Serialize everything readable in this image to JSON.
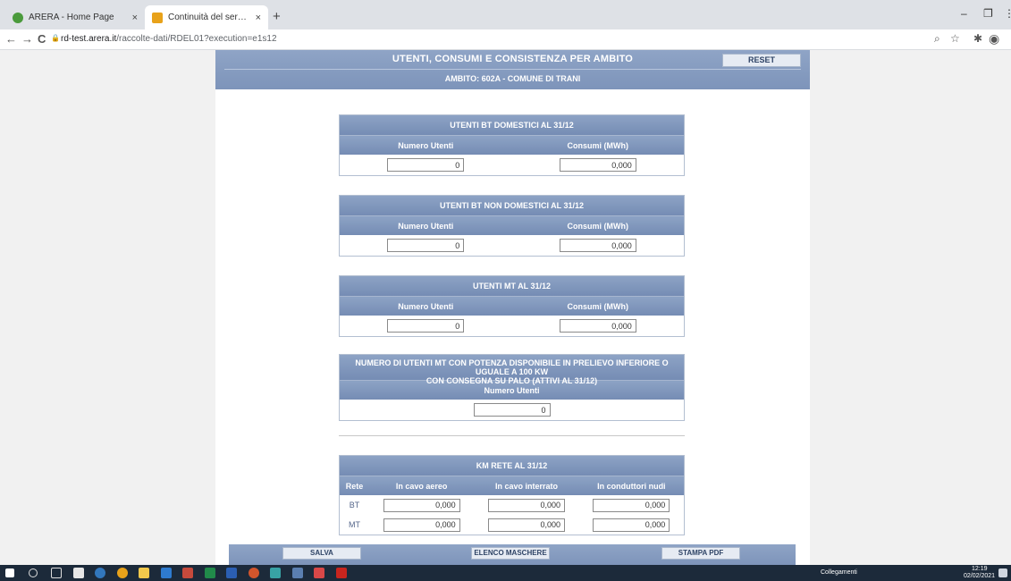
{
  "browser": {
    "tabs": [
      {
        "label": "ARERA - Home Page",
        "close": "×"
      },
      {
        "label": "Continuità del servizio elettrico",
        "close": "×"
      }
    ],
    "new_tab": "+",
    "url_host": "rd-test.arera.it",
    "url_path": "/raccolte-dati/RDEL01?execution=e1s12",
    "minimize": "–",
    "maximize": "❐",
    "kebab": "⋮",
    "back": "←",
    "forward": "→",
    "reload": "C",
    "lock": "🔒",
    "zoom_icon": "⌕",
    "star_icon": "☆",
    "ext_icon": "✱",
    "profile_icon": "◉",
    "colors": {
      "header": "#7d94ba",
      "chrome": "#dee1e6",
      "taskbar": "#1c2a3a"
    }
  },
  "page": {
    "title": "UTENTI, CONSUMI E CONSISTENZA PER AMBITO",
    "subtitle": "AMBITO: 602A - COMUNE DI TRANI",
    "reset_label": "RESET"
  },
  "sections": {
    "bt_domestici": {
      "title": "UTENTI BT DOMESTICI AL 31/12",
      "col1": "Numero Utenti",
      "col2": "Consumi (MWh)",
      "num_utenti": "0",
      "consumi": "0,000"
    },
    "bt_non_domestici": {
      "title": "UTENTI BT NON DOMESTICI AL 31/12",
      "col1": "Numero Utenti",
      "col2": "Consumi (MWh)",
      "num_utenti": "0",
      "consumi": "0,000"
    },
    "mt": {
      "title": "UTENTI MT AL 31/12",
      "col1": "Numero Utenti",
      "col2": "Consumi (MWh)",
      "num_utenti": "0",
      "consumi": "0,000"
    },
    "mt_palo": {
      "title_line1": "NUMERO DI UTENTI MT CON POTENZA DISPONIBILE IN PRELIEVO INFERIORE O UGUALE A 100 KW",
      "title_line2": "CON CONSEGNA SU PALO (ATTIVI AL 31/12)",
      "col1": "Numero Utenti",
      "num_utenti": "0"
    },
    "km_rete": {
      "title": "KM RETE AL 31/12",
      "headers": [
        "Rete",
        "In cavo aereo",
        "In cavo interrato",
        "In conduttori nudi"
      ],
      "rows": [
        {
          "rete": "BT",
          "aereo": "0,000",
          "interrato": "0,000",
          "nudi": "0,000"
        },
        {
          "rete": "MT",
          "aereo": "0,000",
          "interrato": "0,000",
          "nudi": "0,000"
        }
      ]
    }
  },
  "actions": {
    "salva": "SALVA",
    "elenco": "ELENCO MASCHERE",
    "stampa": "STAMPA PDF"
  },
  "taskbar": {
    "collegamenti": "Collegamenti",
    "time": "12:19",
    "date": "02/02/2021"
  }
}
